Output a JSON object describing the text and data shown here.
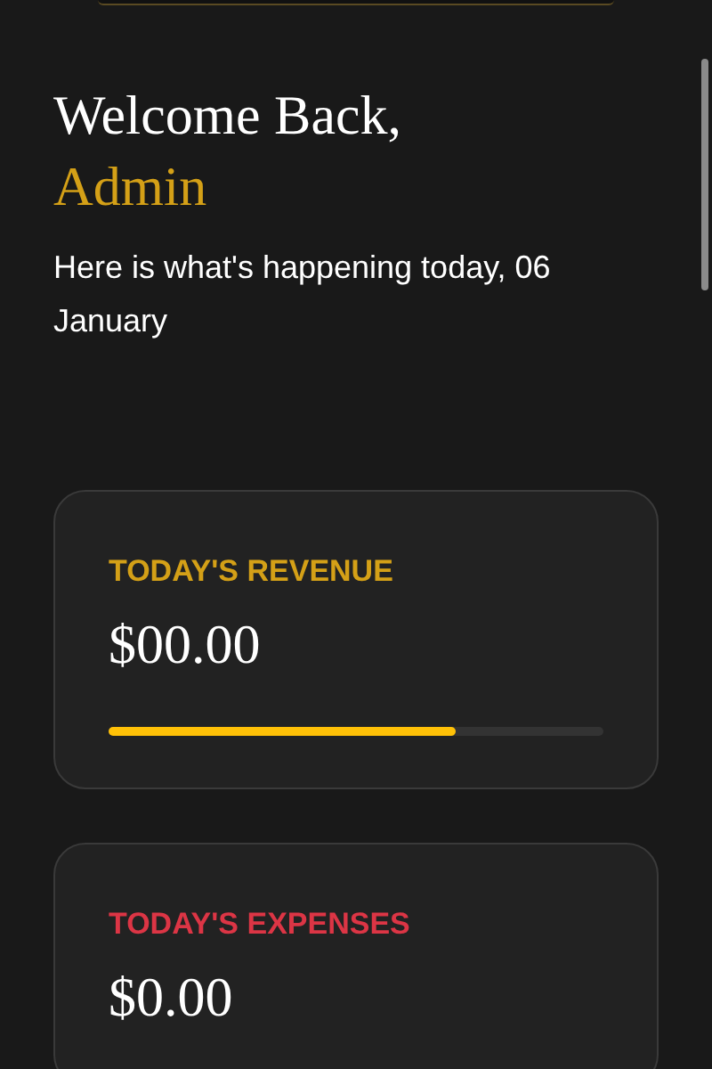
{
  "greeting": {
    "title": "Welcome Back,",
    "name": "Admin",
    "subtitle": "Here is what's happening today, 06 January"
  },
  "cards": [
    {
      "label": "TODAY'S REVENUE",
      "color": "#d4a017",
      "amount": "$00.00",
      "level": 0.7
    },
    {
      "label": "TODAY'S EXPENSES",
      "color": "#dc3545",
      "amount": "$0.00"
    }
  ]
}
